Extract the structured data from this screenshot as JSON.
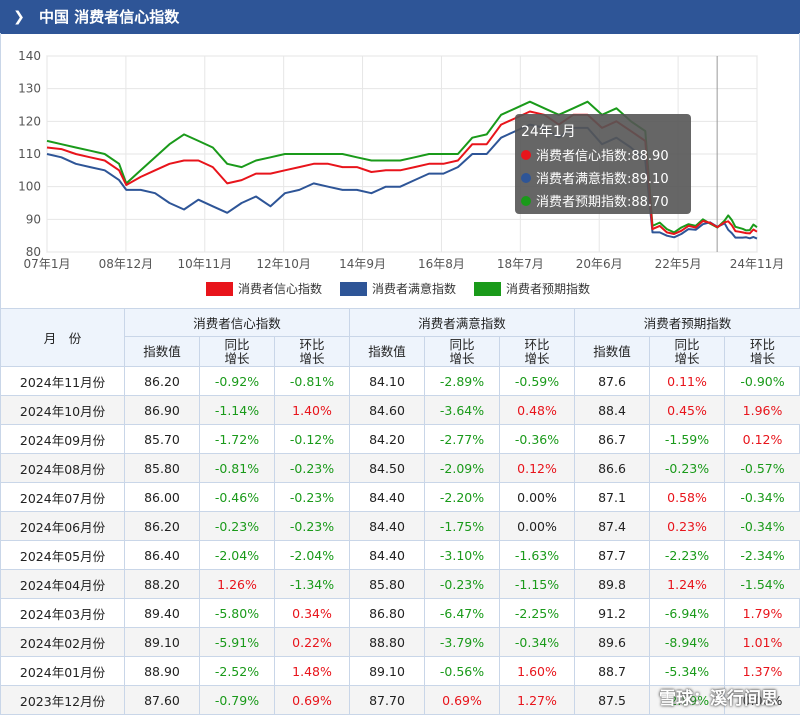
{
  "header": {
    "title": "中国 消费者信心指数"
  },
  "watermark": "雪球：溪行间思",
  "chart_data": {
    "type": "line",
    "x_ticks": [
      "07年1月",
      "08年12月",
      "10年11月",
      "12年10月",
      "14年9月",
      "16年8月",
      "18年7月",
      "20年6月",
      "22年5月",
      "24年11月"
    ],
    "y_ticks": [
      80,
      90,
      100,
      110,
      120,
      130,
      140
    ],
    "ylim": [
      80,
      140
    ],
    "x_range": [
      "2007-01",
      "2024-11"
    ],
    "grid": true,
    "legend_position": "bottom",
    "series": [
      {
        "name": "消费者信心指数",
        "color": "#e8141b",
        "points": [
          [
            0,
            112
          ],
          [
            4,
            111.5
          ],
          [
            8,
            110
          ],
          [
            12,
            109
          ],
          [
            16,
            108
          ],
          [
            20,
            105
          ],
          [
            22,
            100.5
          ],
          [
            26,
            103
          ],
          [
            30,
            105
          ],
          [
            34,
            107
          ],
          [
            38,
            108
          ],
          [
            42,
            108
          ],
          [
            46,
            106
          ],
          [
            50,
            101
          ],
          [
            54,
            102
          ],
          [
            58,
            104
          ],
          [
            62,
            104
          ],
          [
            66,
            105
          ],
          [
            70,
            106
          ],
          [
            74,
            107
          ],
          [
            78,
            107
          ],
          [
            82,
            106
          ],
          [
            86,
            106
          ],
          [
            90,
            104.5
          ],
          [
            94,
            105
          ],
          [
            98,
            105
          ],
          [
            102,
            106
          ],
          [
            106,
            107
          ],
          [
            110,
            107
          ],
          [
            114,
            108
          ],
          [
            118,
            113
          ],
          [
            122,
            113
          ],
          [
            126,
            119
          ],
          [
            130,
            121
          ],
          [
            134,
            123
          ],
          [
            138,
            122
          ],
          [
            142,
            119
          ],
          [
            146,
            122
          ],
          [
            150,
            122
          ],
          [
            154,
            118
          ],
          [
            158,
            120
          ],
          [
            162,
            117
          ],
          [
            166,
            114
          ],
          [
            168,
            87
          ],
          [
            170,
            88
          ],
          [
            172,
            86
          ],
          [
            174,
            85.5
          ],
          [
            176,
            86.5
          ],
          [
            178,
            88
          ],
          [
            180,
            87.5
          ],
          [
            182,
            89.5
          ],
          [
            184,
            88.9
          ],
          [
            186,
            87.6
          ],
          [
            188,
            89.1
          ],
          [
            189,
            89.4
          ],
          [
            190,
            88.2
          ],
          [
            191,
            86.4
          ],
          [
            192,
            86.2
          ],
          [
            193,
            86
          ],
          [
            194,
            85.8
          ],
          [
            195,
            85.7
          ],
          [
            196,
            86.9
          ],
          [
            197,
            86.2
          ]
        ]
      },
      {
        "name": "消费者满意指数",
        "color": "#2e5597",
        "points": [
          [
            0,
            110
          ],
          [
            4,
            109
          ],
          [
            8,
            107
          ],
          [
            12,
            106
          ],
          [
            16,
            105
          ],
          [
            20,
            102
          ],
          [
            22,
            99
          ],
          [
            26,
            99
          ],
          [
            30,
            98
          ],
          [
            34,
            95
          ],
          [
            38,
            93
          ],
          [
            42,
            96
          ],
          [
            46,
            94
          ],
          [
            50,
            92
          ],
          [
            54,
            95
          ],
          [
            58,
            97
          ],
          [
            62,
            94
          ],
          [
            66,
            98
          ],
          [
            70,
            99
          ],
          [
            74,
            101
          ],
          [
            78,
            100
          ],
          [
            82,
            99
          ],
          [
            86,
            99
          ],
          [
            90,
            98
          ],
          [
            94,
            100
          ],
          [
            98,
            100
          ],
          [
            102,
            102
          ],
          [
            106,
            104
          ],
          [
            110,
            104
          ],
          [
            114,
            106
          ],
          [
            118,
            110
          ],
          [
            122,
            110
          ],
          [
            126,
            115
          ],
          [
            130,
            117
          ],
          [
            134,
            119
          ],
          [
            138,
            118
          ],
          [
            142,
            115
          ],
          [
            146,
            118
          ],
          [
            150,
            118
          ],
          [
            154,
            113
          ],
          [
            158,
            115
          ],
          [
            162,
            112
          ],
          [
            166,
            108
          ],
          [
            168,
            86
          ],
          [
            170,
            86
          ],
          [
            172,
            85
          ],
          [
            174,
            84.5
          ],
          [
            176,
            85.5
          ],
          [
            178,
            87
          ],
          [
            180,
            86.8
          ],
          [
            182,
            88.5
          ],
          [
            184,
            89.1
          ],
          [
            186,
            87.7
          ],
          [
            188,
            88.8
          ],
          [
            189,
            86.8
          ],
          [
            190,
            85.8
          ],
          [
            191,
            84.4
          ],
          [
            192,
            84.4
          ],
          [
            193,
            84.4
          ],
          [
            194,
            84.5
          ],
          [
            195,
            84.2
          ],
          [
            196,
            84.6
          ],
          [
            197,
            84.1
          ]
        ]
      },
      {
        "name": "消费者预期指数",
        "color": "#1a9a1a",
        "points": [
          [
            0,
            114
          ],
          [
            4,
            113
          ],
          [
            8,
            112
          ],
          [
            12,
            111
          ],
          [
            16,
            110
          ],
          [
            20,
            107
          ],
          [
            22,
            101
          ],
          [
            26,
            105
          ],
          [
            30,
            109
          ],
          [
            34,
            113
          ],
          [
            38,
            116
          ],
          [
            42,
            114
          ],
          [
            46,
            112
          ],
          [
            50,
            107
          ],
          [
            54,
            106
          ],
          [
            58,
            108
          ],
          [
            62,
            109
          ],
          [
            66,
            110
          ],
          [
            70,
            110
          ],
          [
            74,
            110
          ],
          [
            78,
            110
          ],
          [
            82,
            110
          ],
          [
            86,
            109
          ],
          [
            90,
            108
          ],
          [
            94,
            108
          ],
          [
            98,
            108
          ],
          [
            102,
            109
          ],
          [
            106,
            110
          ],
          [
            110,
            110
          ],
          [
            114,
            110
          ],
          [
            118,
            115
          ],
          [
            122,
            116
          ],
          [
            126,
            122
          ],
          [
            130,
            124
          ],
          [
            134,
            126
          ],
          [
            138,
            124
          ],
          [
            142,
            122
          ],
          [
            146,
            124
          ],
          [
            150,
            126
          ],
          [
            154,
            122
          ],
          [
            158,
            124
          ],
          [
            162,
            120
          ],
          [
            166,
            117
          ],
          [
            168,
            88
          ],
          [
            170,
            89
          ],
          [
            172,
            87
          ],
          [
            174,
            86
          ],
          [
            176,
            87.5
          ],
          [
            178,
            88.5
          ],
          [
            180,
            88
          ],
          [
            182,
            90
          ],
          [
            184,
            88.7
          ],
          [
            186,
            87.5
          ],
          [
            188,
            89.6
          ],
          [
            189,
            91.2
          ],
          [
            190,
            89.8
          ],
          [
            191,
            87.7
          ],
          [
            192,
            87.4
          ],
          [
            193,
            87.1
          ],
          [
            194,
            86.6
          ],
          [
            195,
            86.7
          ],
          [
            196,
            88.4
          ],
          [
            197,
            87.6
          ]
        ]
      }
    ],
    "tooltip": {
      "title": "24年1月",
      "rows": [
        {
          "label": "消费者信心指数:88.90",
          "color": "#e8141b"
        },
        {
          "label": "消费者满意指数:89.10",
          "color": "#2e5597"
        },
        {
          "label": "消费者预期指数:88.70",
          "color": "#1a9a1a"
        }
      ]
    }
  },
  "table": {
    "col_month": "月　份",
    "groups": [
      "消费者信心指数",
      "消费者满意指数",
      "消费者预期指数"
    ],
    "subcols": [
      "指数值",
      "同比\n增长",
      "环比\n增长"
    ],
    "rows": [
      [
        "2024年11月份",
        "86.20",
        "-0.92%",
        "-0.81%",
        "84.10",
        "-2.89%",
        "-0.59%",
        "87.6",
        "0.11%",
        "-0.90%"
      ],
      [
        "2024年10月份",
        "86.90",
        "-1.14%",
        "1.40%",
        "84.60",
        "-3.64%",
        "0.48%",
        "88.4",
        "0.45%",
        "1.96%"
      ],
      [
        "2024年09月份",
        "85.70",
        "-1.72%",
        "-0.12%",
        "84.20",
        "-2.77%",
        "-0.36%",
        "86.7",
        "-1.59%",
        "0.12%"
      ],
      [
        "2024年08月份",
        "85.80",
        "-0.81%",
        "-0.23%",
        "84.50",
        "-2.09%",
        "0.12%",
        "86.6",
        "-0.23%",
        "-0.57%"
      ],
      [
        "2024年07月份",
        "86.00",
        "-0.46%",
        "-0.23%",
        "84.40",
        "-2.20%",
        "0.00%",
        "87.1",
        "0.58%",
        "-0.34%"
      ],
      [
        "2024年06月份",
        "86.20",
        "-0.23%",
        "-0.23%",
        "84.40",
        "-1.75%",
        "0.00%",
        "87.4",
        "0.23%",
        "-0.34%"
      ],
      [
        "2024年05月份",
        "86.40",
        "-2.04%",
        "-2.04%",
        "84.40",
        "-3.10%",
        "-1.63%",
        "87.7",
        "-2.23%",
        "-2.34%"
      ],
      [
        "2024年04月份",
        "88.20",
        "1.26%",
        "-1.34%",
        "85.80",
        "-0.23%",
        "-1.15%",
        "89.8",
        "1.24%",
        "-1.54%"
      ],
      [
        "2024年03月份",
        "89.40",
        "-5.80%",
        "0.34%",
        "86.80",
        "-6.47%",
        "-2.25%",
        "91.2",
        "-6.94%",
        "1.79%"
      ],
      [
        "2024年02月份",
        "89.10",
        "-5.91%",
        "0.22%",
        "88.80",
        "-3.79%",
        "-0.34%",
        "89.6",
        "-8.94%",
        "1.01%"
      ],
      [
        "2024年01月份",
        "88.90",
        "-2.52%",
        "1.48%",
        "89.10",
        "-0.56%",
        "1.60%",
        "88.7",
        "-5.34%",
        "1.37%"
      ],
      [
        "2023年12月份",
        "87.60",
        "-0.79%",
        "0.69%",
        "87.70",
        "0.69%",
        "1.27%",
        "87.5",
        "-2.89%",
        "0.00%"
      ]
    ]
  }
}
